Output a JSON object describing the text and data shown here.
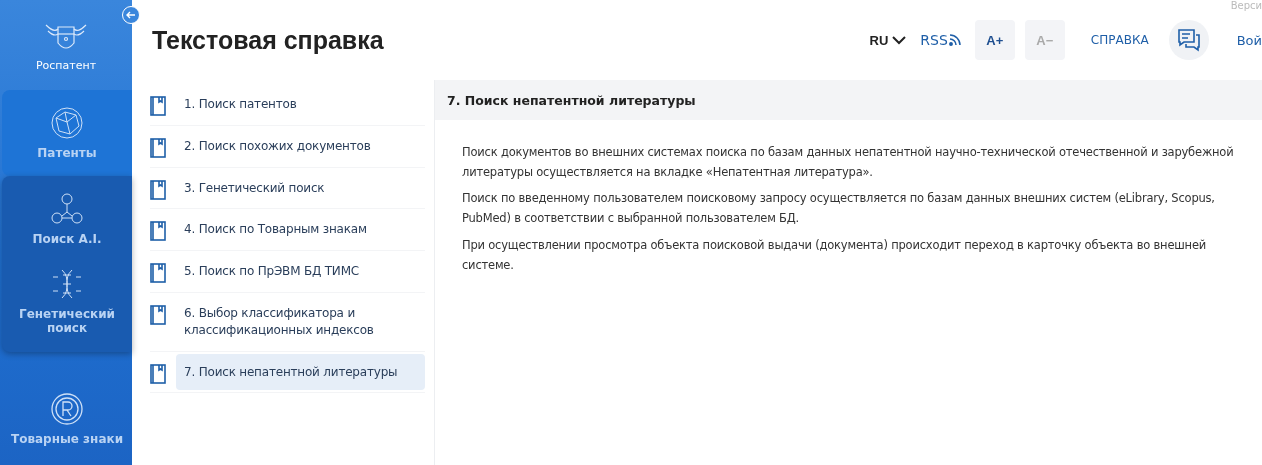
{
  "sidebar": {
    "logo_text": "Роспатент",
    "nav": [
      {
        "kind": "selected",
        "items": [
          {
            "label": "Патенты"
          }
        ]
      },
      {
        "kind": "shaded",
        "items": [
          {
            "label": "Поиск A.I."
          },
          {
            "label": "Генетический поиск"
          }
        ]
      },
      {
        "kind": "plain",
        "items": [
          {
            "label": "Товарные знаки"
          }
        ]
      }
    ]
  },
  "header": {
    "title": "Текстовая справка",
    "version_text": "Верси",
    "language": "RU",
    "rss": "RSS",
    "font_increase": {
      "label": "A+",
      "disabled": false
    },
    "font_decrease": {
      "label": "A−",
      "disabled": true
    },
    "help": "СПРАВКА",
    "login": "Вой"
  },
  "toc": [
    {
      "label": "1. Поиск патентов",
      "selected": false
    },
    {
      "label": "2. Поиск похожих документов",
      "selected": false
    },
    {
      "label": "3. Генетический поиск",
      "selected": false
    },
    {
      "label": "4. Поиск по Товарным знакам",
      "selected": false
    },
    {
      "label": "5. Поиск по ПрЭВМ БД ТИМС",
      "selected": false
    },
    {
      "label": "6. Выбор классификатора и классификационных индексов",
      "selected": false
    },
    {
      "label": "7. Поиск непатентной литературы",
      "selected": true
    }
  ],
  "article": {
    "title": "7. Поиск непатентной литературы",
    "paragraphs": [
      "Поиск документов во внешних системах поиска по базам данных непатентной научно-технической отечественной и зарубежной литературы осуществляется на вкладке «Непатентная литература».",
      "Поиск по введенному пользователем поисковому запросу осуществляется по базам данных внешних систем (eLibrary, Scopus, PubMed) в соответствии с выбранной пользователем БД.",
      "При осуществлении просмотра объекта поисковой выдачи (документа) происходит переход в карточку объекта во внешней системе."
    ]
  }
}
